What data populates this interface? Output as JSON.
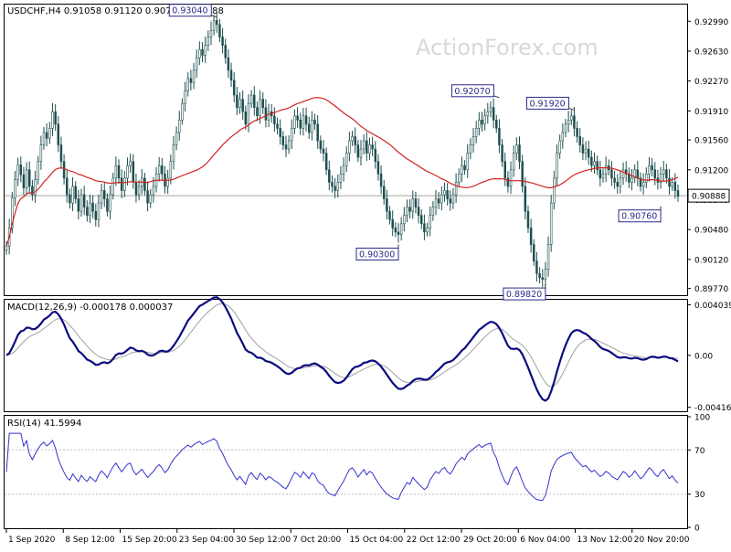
{
  "header": {
    "symbol_line": "USDCHF,H4  0.91058 0.91120 0.90791 0.90888",
    "watermark": "ActionForex.com"
  },
  "colors": {
    "candle": "#1f4f4f",
    "ma": "#d42020",
    "macd": "#0b0b80",
    "signal": "#a0a0a0",
    "rsi": "#3333cc",
    "axis": "#000000",
    "grid": "#bdbdbd",
    "label_fill": "#ffffff",
    "label_border": "#2a2a8a"
  },
  "chart_data": [
    {
      "type": "candlestick",
      "title": "USDCHF,H4",
      "ohlc_last": {
        "open": 0.91058,
        "high": 0.9112,
        "low": 0.90791,
        "close": 0.90888
      },
      "current_price": "0.90888",
      "ylim": [
        0.897,
        0.9318
      ],
      "y_ticks": [
        "0.92990",
        "0.92630",
        "0.92270",
        "0.91910",
        "0.91560",
        "0.91200",
        "0.90840",
        "0.90480",
        "0.90120",
        "0.89770"
      ],
      "y_tick_values": [
        0.9299,
        0.9263,
        0.9227,
        0.9191,
        0.9156,
        0.912,
        0.9084,
        0.9048,
        0.9012,
        0.8977
      ],
      "x_ticks": [
        "1 Sep 2020",
        "8 Sep 12:00",
        "15 Sep 20:00",
        "23 Sep 04:00",
        "30 Sep 12:00",
        "7 Oct 20:00",
        "15 Oct 04:00",
        "22 Oct 12:00",
        "29 Oct 20:00",
        "6 Nov 04:00",
        "13 Nov 12:00",
        "20 Nov 20:00"
      ],
      "annotations": [
        {
          "label": "0.93040",
          "bar": 73
        },
        {
          "label": "0.92070",
          "bar": 171
        },
        {
          "label": "0.91920",
          "bar": 197
        },
        {
          "label": "0.90300",
          "bar": 136
        },
        {
          "label": "0.89820",
          "bar": 187
        },
        {
          "label": "0.90760",
          "bar": 227
        }
      ],
      "closes": [
        0.9028,
        0.905,
        0.9086,
        0.9108,
        0.9126,
        0.9114,
        0.9098,
        0.912,
        0.91,
        0.909,
        0.9108,
        0.913,
        0.915,
        0.9165,
        0.9158,
        0.917,
        0.919,
        0.9175,
        0.915,
        0.913,
        0.911,
        0.909,
        0.908,
        0.91,
        0.9085,
        0.907,
        0.909,
        0.9075,
        0.9065,
        0.908,
        0.907,
        0.906,
        0.908,
        0.9095,
        0.9085,
        0.907,
        0.909,
        0.911,
        0.9125,
        0.911,
        0.9095,
        0.911,
        0.9125,
        0.913,
        0.9105,
        0.909,
        0.91,
        0.911,
        0.9095,
        0.908,
        0.909,
        0.91,
        0.9115,
        0.9125,
        0.9115,
        0.91,
        0.911,
        0.913,
        0.915,
        0.9165,
        0.918,
        0.92,
        0.9215,
        0.923,
        0.9225,
        0.924,
        0.9255,
        0.9265,
        0.9258,
        0.927,
        0.928,
        0.9288,
        0.93,
        0.9295,
        0.928,
        0.927,
        0.9255,
        0.924,
        0.9228,
        0.921,
        0.9195,
        0.9205,
        0.919,
        0.9175,
        0.92,
        0.921,
        0.9195,
        0.9185,
        0.9205,
        0.9195,
        0.918,
        0.919,
        0.9185,
        0.9175,
        0.917,
        0.916,
        0.915,
        0.9145,
        0.9155,
        0.917,
        0.9185,
        0.918,
        0.917,
        0.9185,
        0.9175,
        0.9165,
        0.918,
        0.9175,
        0.9155,
        0.9145,
        0.914,
        0.912,
        0.9105,
        0.91,
        0.9095,
        0.9105,
        0.9115,
        0.9125,
        0.914,
        0.9155,
        0.916,
        0.915,
        0.9135,
        0.9145,
        0.9155,
        0.914,
        0.915,
        0.9145,
        0.913,
        0.9115,
        0.91,
        0.9085,
        0.907,
        0.906,
        0.905,
        0.9045,
        0.9042,
        0.9055,
        0.9065,
        0.9075,
        0.907,
        0.9085,
        0.9075,
        0.9065,
        0.9055,
        0.9045,
        0.905,
        0.9065,
        0.9075,
        0.9085,
        0.908,
        0.909,
        0.9095,
        0.9085,
        0.908,
        0.909,
        0.9105,
        0.9115,
        0.9125,
        0.912,
        0.914,
        0.915,
        0.916,
        0.917,
        0.918,
        0.9175,
        0.9185,
        0.919,
        0.9195,
        0.918,
        0.917,
        0.915,
        0.913,
        0.911,
        0.91,
        0.912,
        0.914,
        0.915,
        0.913,
        0.91,
        0.907,
        0.905,
        0.903,
        0.901,
        0.8995,
        0.899,
        0.8988,
        0.9,
        0.903,
        0.908,
        0.911,
        0.914,
        0.9155,
        0.9165,
        0.9175,
        0.918,
        0.9185,
        0.917,
        0.916,
        0.915,
        0.914,
        0.9145,
        0.9135,
        0.9125,
        0.913,
        0.912,
        0.911,
        0.9115,
        0.9125,
        0.912,
        0.911,
        0.9105,
        0.91,
        0.911,
        0.912,
        0.9115,
        0.9105,
        0.911,
        0.912,
        0.911,
        0.91,
        0.9105,
        0.9115,
        0.9125,
        0.912,
        0.911,
        0.9105,
        0.9115,
        0.912,
        0.911,
        0.91,
        0.9105,
        0.9095,
        0.9088
      ]
    },
    {
      "type": "line",
      "title": "MACD(12,26,9) -0.000178 0.000037",
      "ylim": [
        -0.0044,
        0.0043
      ],
      "y_ticks": [
        "0.004039",
        "0.00",
        "-0.00416"
      ],
      "y_tick_values": [
        0.004039,
        0.0,
        -0.00416
      ]
    },
    {
      "type": "line",
      "title": "RSI(14) 41.5994",
      "ylim": [
        0,
        100
      ],
      "y_ticks": [
        "100",
        "70",
        "30",
        "0"
      ],
      "y_tick_values": [
        100,
        70,
        30,
        0
      ]
    }
  ]
}
